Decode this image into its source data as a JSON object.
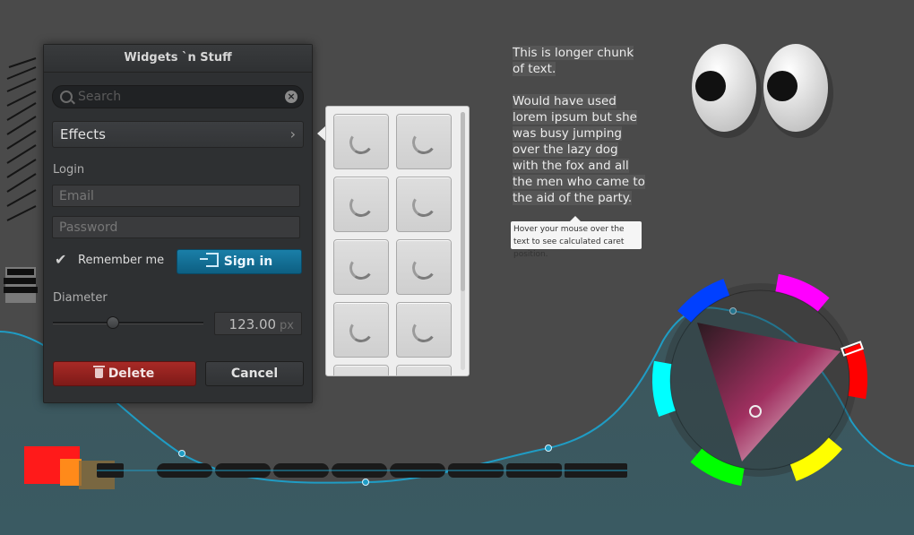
{
  "window": {
    "title": "Widgets `n Stuff",
    "search": {
      "placeholder": "Search",
      "value": ""
    },
    "effects_label": "Effects",
    "login_label": "Login",
    "email_placeholder": "Email",
    "password_placeholder": "Password",
    "remember_label": "Remember me",
    "remember_checked": true,
    "signin_label": "Sign in",
    "diameter_label": "Diameter",
    "diameter_value": "123.00",
    "diameter_unit": "px",
    "diameter_slider_fraction": 0.4,
    "delete_label": "Delete",
    "cancel_label": "Cancel"
  },
  "image_grid": {
    "tile_count_visible": 8,
    "state": "loading"
  },
  "text_panel": {
    "paragraph1": "This is longer chunk of text.",
    "paragraph2": "Would have used lorem ipsum but she    was busy jumping over the lazy dog with the fox and all the men who came to the aid of the party.",
    "tooltip": "Hover your mouse over the text to see calculated caret position."
  },
  "colors": {
    "background": "#4a4a4a",
    "accent_blue": "#1a7fa8",
    "danger_red": "#a82a26",
    "curve": "#1f9cc4",
    "bottom_band": "#3a5a62",
    "color_wheel_selected": "#e0307a"
  },
  "icons": [
    "search-icon",
    "clear-icon",
    "chevron-right-icon",
    "checkmark-icon",
    "login-icon",
    "trash-icon",
    "spinner-icon"
  ]
}
